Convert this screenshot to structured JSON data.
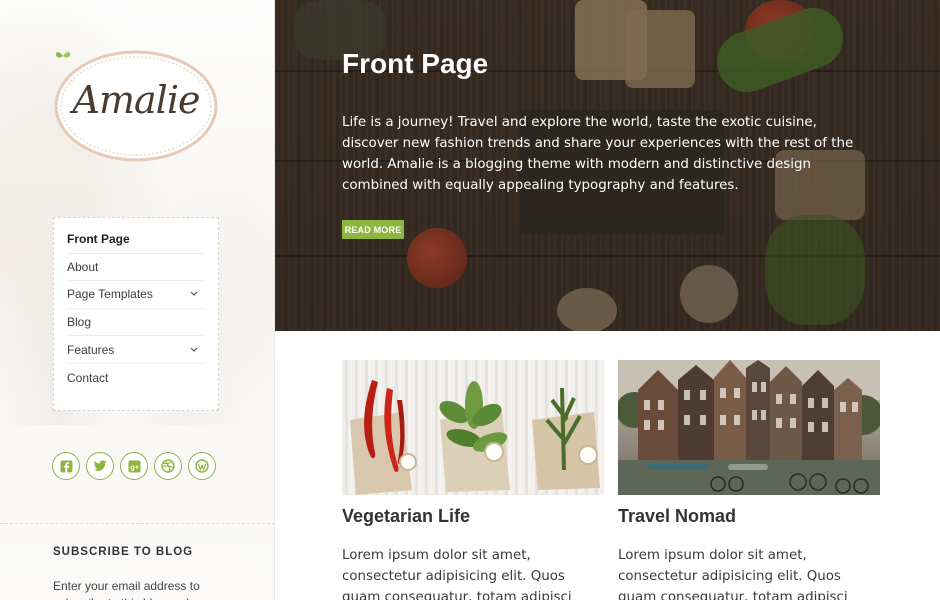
{
  "brand": {
    "logo_text": "Amalie",
    "accent_color": "#8db53f"
  },
  "nav": {
    "items": [
      {
        "label": "Front Page",
        "active": true,
        "has_submenu": false
      },
      {
        "label": "About",
        "active": false,
        "has_submenu": false
      },
      {
        "label": "Page Templates",
        "active": false,
        "has_submenu": true
      },
      {
        "label": "Blog",
        "active": false,
        "has_submenu": false
      },
      {
        "label": "Features",
        "active": false,
        "has_submenu": true
      },
      {
        "label": "Contact",
        "active": false,
        "has_submenu": false
      }
    ]
  },
  "social": {
    "icons": [
      "facebook-icon",
      "twitter-icon",
      "google-plus-icon",
      "dribbble-icon",
      "wordpress-icon"
    ]
  },
  "subscribe": {
    "title": "SUBSCRIBE TO BLOG",
    "text": "Enter your email address to subscribe to this blog and"
  },
  "hero": {
    "title": "Front Page",
    "text": "Life is a journey! Travel and explore the world, taste the exotic cuisine, discover new fashion trends and share your experiences with the rest of the world. Amalie is a blogging theme with modern and distinctive design combined with equally appealing typography and features.",
    "button_label": "READ MORE"
  },
  "posts": [
    {
      "title": "Vegetarian Life",
      "excerpt": "Lorem ipsum dolor sit amet, consectetur adipisicing elit. Quos quam consequatur, totam adipisci alias perspiciatis, quidem"
    },
    {
      "title": "Travel Nomad",
      "excerpt": "Lorem ipsum dolor sit amet, consectetur adipisicing elit. Quos quam consequatur, totam adipisci alias perspiciatis, quidem"
    }
  ]
}
